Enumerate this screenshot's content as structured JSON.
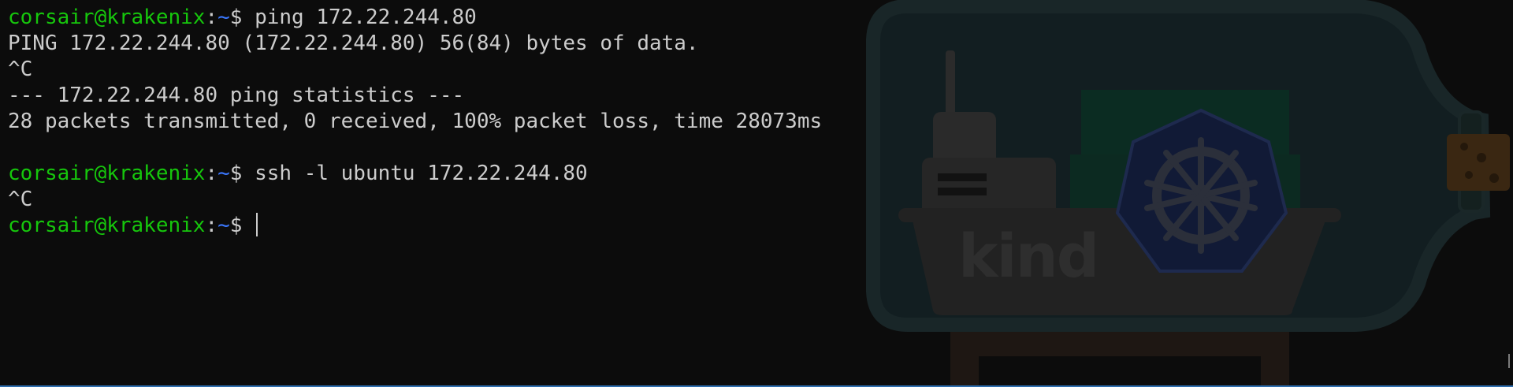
{
  "terminal": {
    "background_color": "#0c0c0c",
    "text_color": "#cccccc",
    "user_color": "#16c60c",
    "path_color": "#3b78ff",
    "background_image_text": "kind",
    "prompt": {
      "user_host": "corsair@krakenix",
      "colon": ":",
      "path": "~",
      "symbol": "$"
    },
    "lines": [
      {
        "type": "prompt",
        "command": " ping 172.22.244.80"
      },
      {
        "type": "output",
        "text": "PING 172.22.244.80 (172.22.244.80) 56(84) bytes of data."
      },
      {
        "type": "output",
        "text": "^C"
      },
      {
        "type": "output",
        "text": "--- 172.22.244.80 ping statistics ---"
      },
      {
        "type": "output",
        "text": "28 packets transmitted, 0 received, 100% packet loss, time 28073ms"
      },
      {
        "type": "output",
        "text": ""
      },
      {
        "type": "prompt",
        "command": " ssh -l ubuntu 172.22.244.80"
      },
      {
        "type": "output",
        "text": "^C"
      },
      {
        "type": "prompt",
        "command": " "
      }
    ]
  }
}
